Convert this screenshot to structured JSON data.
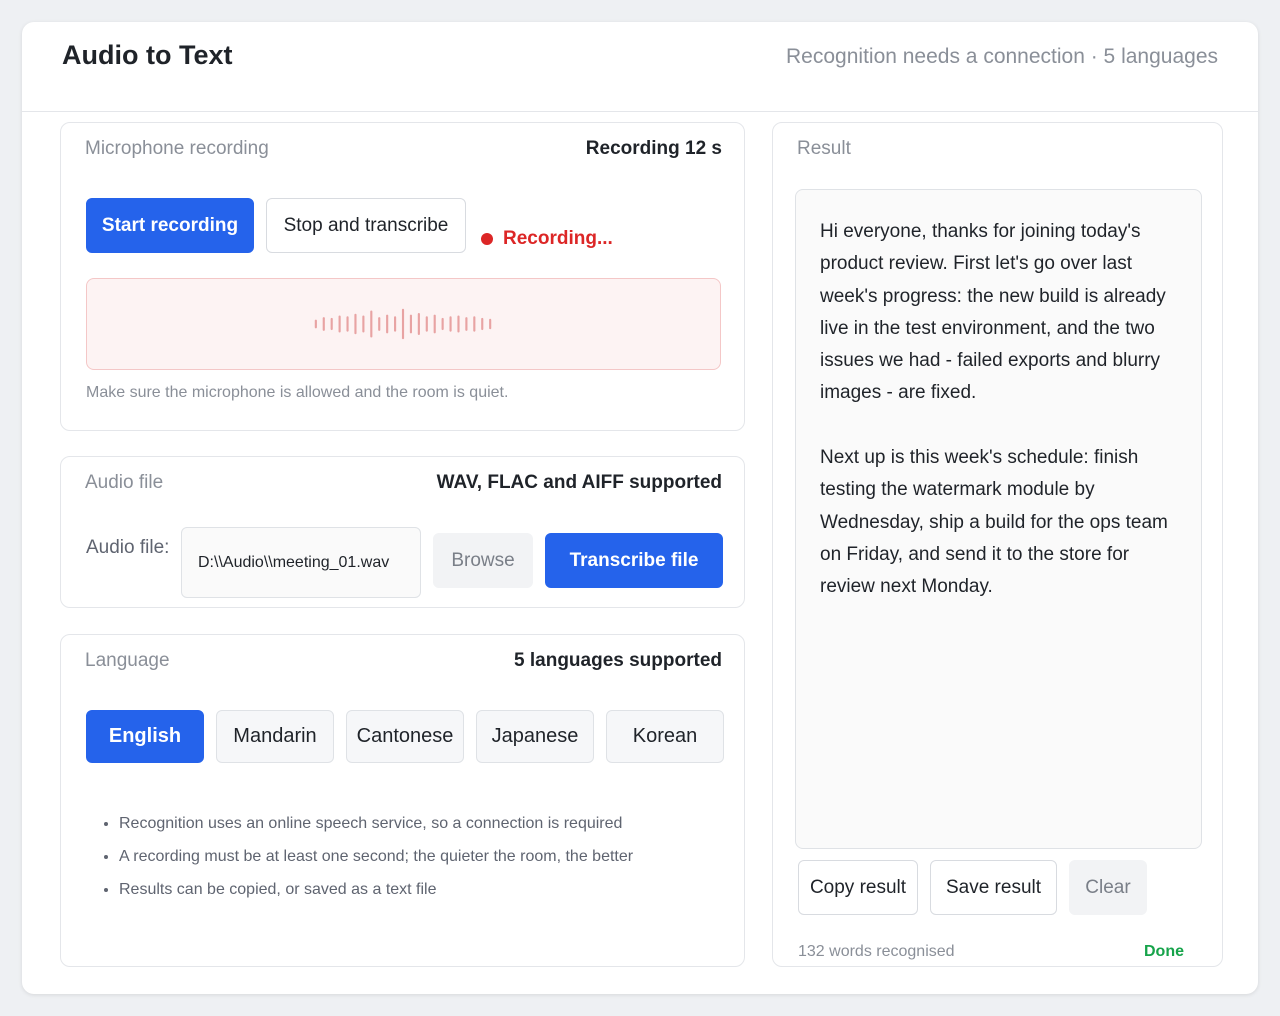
{
  "app": {
    "title": "Audio to Text",
    "info": "Recognition needs a connection · 5 languages"
  },
  "recording": {
    "title": "Microphone recording",
    "timer": "Recording 12 s",
    "start_label": "Start recording",
    "stop_label": "Stop and transcribe",
    "status": "Recording...",
    "hint": "Make sure the microphone is allowed and the room is quiet.",
    "waveform_levels": [
      0.2,
      0.35,
      0.3,
      0.45,
      0.4,
      0.55,
      0.45,
      0.75,
      0.35,
      0.5,
      0.4,
      0.85,
      0.5,
      0.6,
      0.4,
      0.5,
      0.3,
      0.4,
      0.45,
      0.35,
      0.4,
      0.3,
      0.25
    ]
  },
  "file": {
    "title": "Audio file",
    "formats": "WAV, FLAC and AIFF supported",
    "label": "Audio file:",
    "path": "D:\\\\Audio\\\\meeting_01.wav",
    "browse_label": "Browse",
    "transcribe_label": "Transcribe file"
  },
  "language": {
    "title": "Language",
    "count": "5 languages supported",
    "options": [
      "English",
      "Mandarin",
      "Cantonese",
      "Japanese",
      "Korean"
    ],
    "selected": "English",
    "notes": [
      "Recognition uses an online speech service, so a connection is required",
      "A recording must be at least one second; the quieter the room, the better",
      "Results can be copied, or saved as a text file"
    ]
  },
  "result": {
    "title": "Result",
    "text": "Hi everyone, thanks for joining today's product review. First let's go over last week's progress: the new build is already live in the test environment, and the two issues we had - failed exports and blurry images - are fixed.\n\nNext up is this week's schedule: finish testing the watermark module by Wednesday, ship a build for the ops team on Friday, and send it to the store for review next Monday.",
    "copy_label": "Copy result",
    "save_label": "Save result",
    "clear_label": "Clear",
    "word_count": "132 words recognised",
    "status": "Done"
  },
  "colors": {
    "accent": "#2563eb",
    "recording": "#dc2626",
    "success": "#16a34a"
  }
}
